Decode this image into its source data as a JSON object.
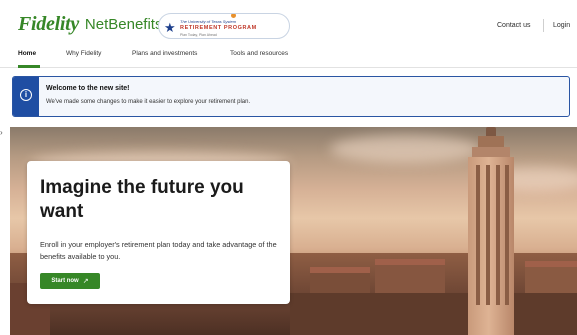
{
  "header": {
    "brand": "Fidelity",
    "product": "NetBenefits",
    "product_mark": "®",
    "partner": {
      "line1": "The University of Texas System",
      "line2": "RETIREMENT PROGRAM",
      "line3": "Plan Today, Plan Ahead"
    },
    "contact_label": "Contact us",
    "login_label": "Login"
  },
  "nav": {
    "items": [
      {
        "label": "Home",
        "active": true
      },
      {
        "label": "Why Fidelity",
        "active": false
      },
      {
        "label": "Plans and investments",
        "active": false
      },
      {
        "label": "Tools and resources",
        "active": false
      }
    ]
  },
  "alert": {
    "icon": "info-icon",
    "title": "Welcome to the new site!",
    "body": "We've made some changes to make it easier to explore your retirement plan."
  },
  "hero": {
    "title": "Imagine the future you want",
    "description": "Enroll in your employer's retirement plan today and take advantage of the benefits available to you.",
    "cta_label": "Start now",
    "cta_icon": "external-link-icon"
  },
  "colors": {
    "brand_green": "#368727",
    "alert_blue": "#1f4ea3",
    "partner_navy": "#1d3f8c",
    "partner_red": "#c0392b"
  }
}
